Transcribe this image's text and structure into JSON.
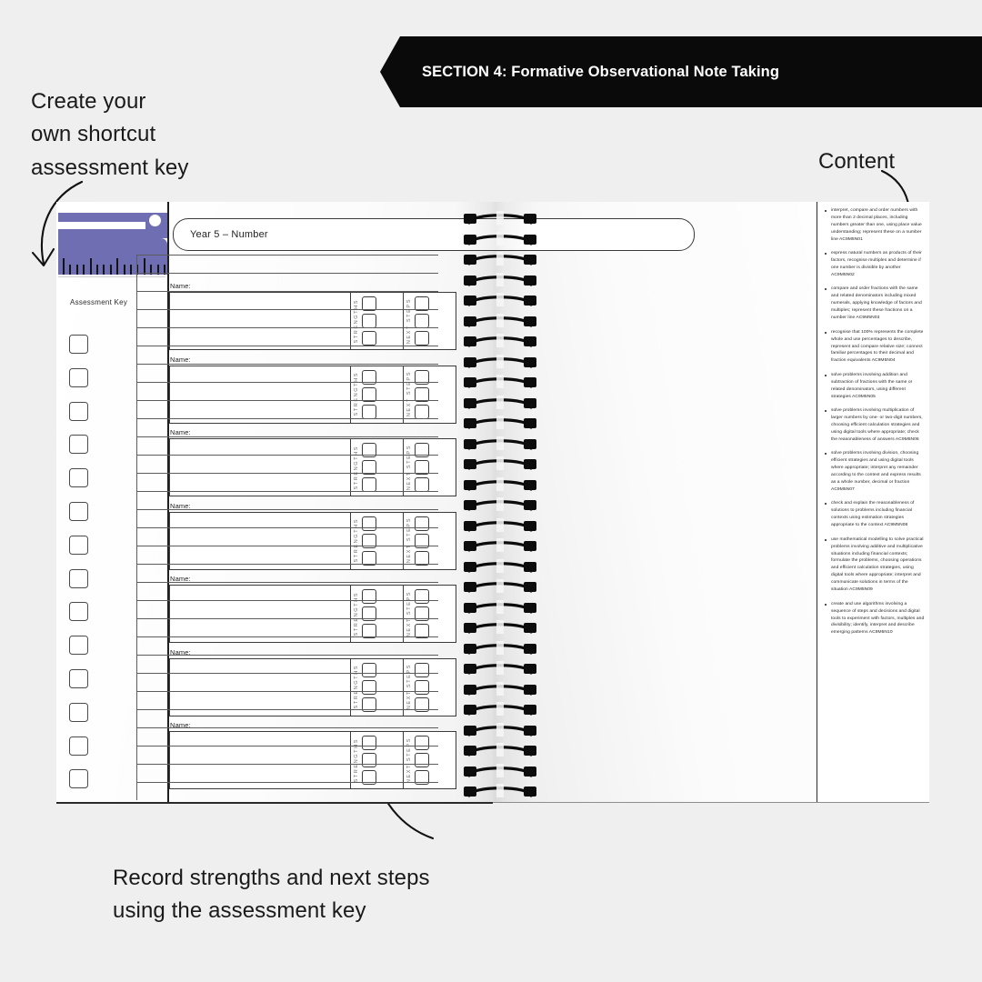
{
  "header": {
    "banner_label": "SECTION 4: Formative Observational Note Taking"
  },
  "annotations": {
    "left": "Create your\nown shortcut\nassessment key",
    "content": "Content",
    "bottom": "Record strengths and next steps\nusing the assessment key"
  },
  "notebook": {
    "title_pill": "Year 5 – Number",
    "assessment_key": {
      "label": "Assessment Key",
      "checkbox_count": 14
    },
    "rows": [
      {
        "name_label": "Name:",
        "strengths_label": "STRENGTHS",
        "next_steps_label": "NEXT STEPS",
        "checkbox_count": 3
      },
      {
        "name_label": "Name:",
        "strengths_label": "STRENGTHS",
        "next_steps_label": "NEXT STEPS",
        "checkbox_count": 3
      },
      {
        "name_label": "Name:",
        "strengths_label": "STRENGTHS",
        "next_steps_label": "NEXT STEPS",
        "checkbox_count": 3
      },
      {
        "name_label": "Name:",
        "strengths_label": "STRENGTHS",
        "next_steps_label": "NEXT STEPS",
        "checkbox_count": 3
      },
      {
        "name_label": "Name:",
        "strengths_label": "STRENGTHS",
        "next_steps_label": "NEXT STEPS",
        "checkbox_count": 3
      },
      {
        "name_label": "Name:",
        "strengths_label": "STRENGTHS",
        "next_steps_label": "NEXT STEPS",
        "checkbox_count": 3
      },
      {
        "name_label": "Name:",
        "strengths_label": "STRENGTHS",
        "next_steps_label": "NEXT STEPS",
        "checkbox_count": 3
      }
    ],
    "ruled_line_count": 30,
    "spiral_coil_count": 29,
    "content_bullets": [
      "interpret, compare and order numbers with more than 2 decimal places, including numbers greater than one, using place value understanding; represent these on a number line AC9M5N01",
      "express natural numbers as products of their factors, recognise multiples and determine if one number is divisible by another AC9M5N02",
      "compare and order fractions with the same and related denominators including mixed numerals, applying knowledge of factors and multiples; represent these fractions on a number line AC9M5N03",
      "recognise that 100% represents the complete whole and use percentages to describe, represent and compare relative size; connect familiar percentages to their decimal and fraction equivalents AC9M5N04",
      "solve problems involving addition and subtraction of fractions with the same or related denominators, using different strategies AC9M5N05",
      "solve problems involving multiplication of larger numbers by one- or two-digit numbers, choosing efficient calculation strategies and using digital tools where appropriate; check the reasonableness of answers AC9M5N06",
      "solve problems involving division, choosing efficient strategies and using digital tools where appropriate; interpret any remainder according to the context and express results as a whole number, decimal or fraction AC9M5N07",
      "check and explain the reasonableness of solutions to problems including financial contexts using estimation strategies appropriate to the context AC9M5N08",
      "use mathematical modelling to solve practical problems involving additive and multiplicative situations including financial contexts; formulate the problems, choosing operations and efficient calculation strategies, using digital tools where appropriate; interpret and communicate solutions in terms of the situation AC9M5N09",
      "create and use algorithms involving a sequence of steps and decisions and digital tools to experiment with factors, multiples and divisibility; identify, interpret and describe emerging patterns AC9M5N10"
    ]
  },
  "colors": {
    "page_background": "#efefef",
    "banner": "#0a0a0a",
    "ruler_purple": "#6f6eb2",
    "paper": "#ffffff",
    "ink": "#1a1a1a"
  }
}
